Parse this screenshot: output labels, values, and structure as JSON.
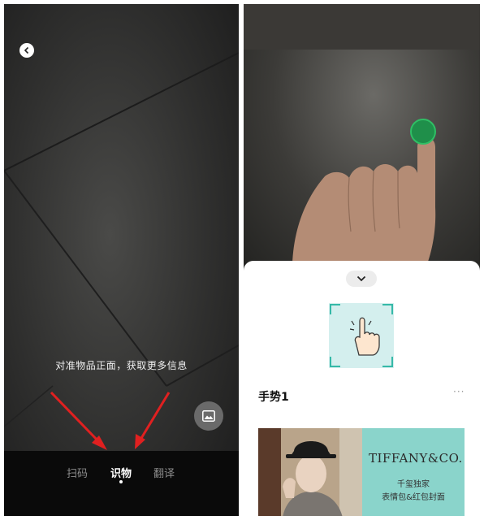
{
  "scan_screen": {
    "hint_text": "对准物品正面，获取更多信息",
    "modes": [
      "扫码",
      "识物",
      "翻译"
    ],
    "active_mode": "识物"
  },
  "gesture_screen": {
    "gesture_title": "手势1",
    "more_label": "···",
    "banner": {
      "brand": "TIFFANY&CO.",
      "line1": "千玺独家",
      "line2": "表情包&红包封面"
    }
  },
  "colors": {
    "dot_green": "#1f8f4a",
    "banner_teal": "#8ad4cb",
    "gesture_tile": "#d4efee",
    "arrow_red": "#e02020"
  }
}
